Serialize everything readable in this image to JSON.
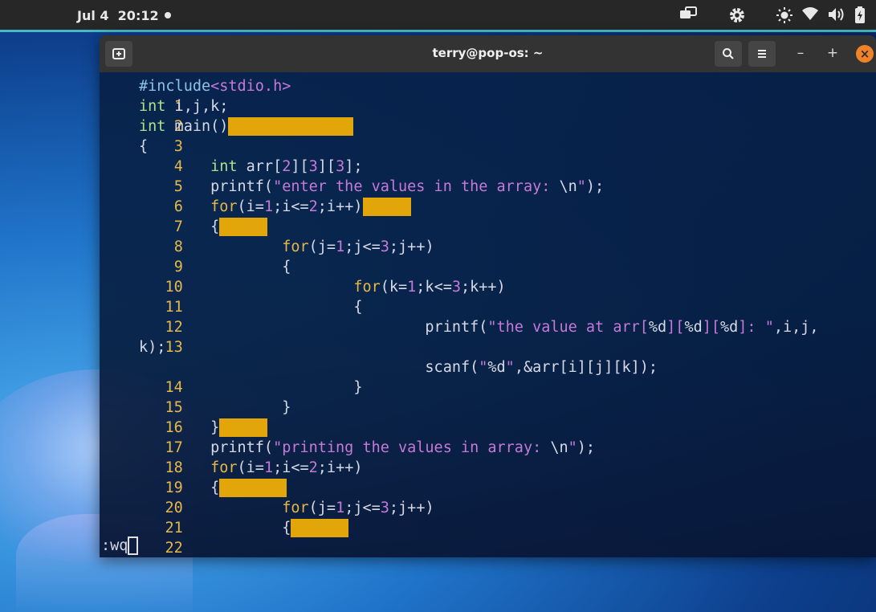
{
  "topbar": {
    "date": "Jul 4",
    "time": "20:12",
    "icons": [
      "window-switcher-icon",
      "gear-icon",
      "brightness-icon",
      "wifi-icon",
      "volume-icon",
      "battery-icon"
    ]
  },
  "window": {
    "title": "terry@pop-os: ~",
    "new_tab_icon": "new-tab-icon",
    "search_icon": "search-icon",
    "menu_icon": "hamburger-menu-icon",
    "minimize": "–",
    "maximize": "+",
    "close": "×"
  },
  "editor": {
    "lines": [
      {
        "n": "1"
      },
      {
        "n": "2"
      },
      {
        "n": "3"
      },
      {
        "n": "4"
      },
      {
        "n": "5"
      },
      {
        "n": "6"
      },
      {
        "n": "7"
      },
      {
        "n": "8"
      },
      {
        "n": "9"
      },
      {
        "n": "10"
      },
      {
        "n": "11"
      },
      {
        "n": "12"
      },
      {
        "n": "13"
      },
      {
        "n": "14"
      },
      {
        "n": "15"
      },
      {
        "n": "16"
      },
      {
        "n": "17"
      },
      {
        "n": "18"
      },
      {
        "n": "19"
      },
      {
        "n": "20"
      },
      {
        "n": "21"
      },
      {
        "n": "22"
      }
    ],
    "code": {
      "l1_a": "#include",
      "l1_b": "<stdio.h>",
      "l2_a": "int",
      "l2_b": " i,j,k;",
      "l3_a": "int",
      "l3_b": " main()",
      "l4": "{",
      "l5_a": "int",
      "l5_b": " arr[",
      "l5_c": "2",
      "l5_d": "][",
      "l5_e": "3",
      "l5_f": "][",
      "l5_g": "3",
      "l5_h": "];",
      "l6_a": "printf(",
      "l6_b": "\"enter the values in the array: ",
      "l6_c": "\\n",
      "l6_d": "\"",
      "l6_e": ");",
      "l7_a": "for",
      "l7_b": "(i=",
      "l7_c": "1",
      "l7_d": ";i<=",
      "l7_e": "2",
      "l7_f": ";i++)",
      "l8": "{",
      "l9_a": "for",
      "l9_b": "(j=",
      "l9_c": "1",
      "l9_d": ";j<=",
      "l9_e": "3",
      "l9_f": ";j++)",
      "l10": "{",
      "l11_a": "for",
      "l11_b": "(k=",
      "l11_c": "1",
      "l11_d": ";k<=",
      "l11_e": "3",
      "l11_f": ";k++)",
      "l12": "{",
      "l13_a": "printf(",
      "l13_b": "\"the value at arr[",
      "l13_c": "%d",
      "l13_d": "][",
      "l13_e": "%d",
      "l13_f": "][",
      "l13_g": "%d",
      "l13_h": "]: \"",
      "l13_i": ",i,j,",
      "l13_wrap": "k);",
      "l14_a": "scanf(",
      "l14_b": "\"",
      "l14_c": "%d",
      "l14_d": "\"",
      "l14_e": ",&arr[i][j][k]);",
      "l15": "}",
      "l16": "}",
      "l17": "}",
      "l18_a": "printf(",
      "l18_b": "\"printing the values in array: ",
      "l18_c": "\\n",
      "l18_d": "\"",
      "l18_e": ");",
      "l19_a": "for",
      "l19_b": "(i=",
      "l19_c": "1",
      "l19_d": ";i<=",
      "l19_e": "2",
      "l19_f": ";i++)",
      "l20": "{",
      "l21_a": "for",
      "l21_b": "(j=",
      "l21_c": "1",
      "l21_d": ";j<=",
      "l21_e": "3",
      "l21_f": ";j++)",
      "l22": "{"
    },
    "command": ":wq"
  },
  "colors": {
    "accent": "#48b9c7",
    "line_number": "#e6b84a",
    "keyword": "#e6b84a",
    "type": "#a9e28a",
    "string": "#c67ad8",
    "highlight": "#e3a60a",
    "close_button": "#f0832a"
  }
}
